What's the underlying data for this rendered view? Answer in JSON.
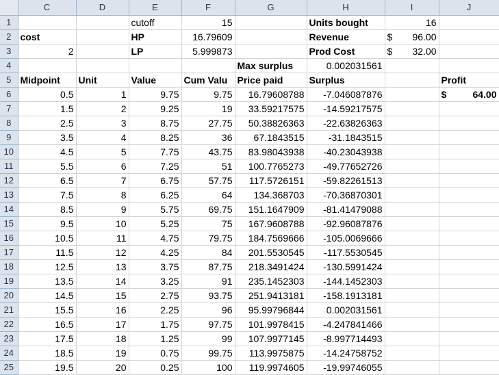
{
  "columns": [
    "C",
    "D",
    "E",
    "F",
    "G",
    "H",
    "I",
    "J"
  ],
  "rows": [
    {
      "n": "1",
      "cells": [
        {
          "v": ""
        },
        {
          "v": ""
        },
        {
          "v": "cutoff",
          "t": "txt"
        },
        {
          "v": "15",
          "t": "num"
        },
        {
          "v": ""
        },
        {
          "v": "Units bought",
          "t": "txt",
          "b": true
        },
        {
          "v": "16",
          "t": "num"
        },
        {
          "v": ""
        }
      ]
    },
    {
      "n": "2",
      "cells": [
        {
          "v": "cost",
          "t": "txt",
          "b": true
        },
        {
          "v": ""
        },
        {
          "v": "HP",
          "t": "txt",
          "b": true
        },
        {
          "v": "16.79609",
          "t": "num"
        },
        {
          "v": ""
        },
        {
          "v": "Revenue",
          "t": "txt",
          "b": true
        },
        {
          "v": "96.00",
          "t": "cur",
          "s": "$"
        },
        {
          "v": ""
        }
      ]
    },
    {
      "n": "3",
      "cells": [
        {
          "v": "2",
          "t": "num"
        },
        {
          "v": ""
        },
        {
          "v": "LP",
          "t": "txt",
          "b": true
        },
        {
          "v": "5.999873",
          "t": "num"
        },
        {
          "v": ""
        },
        {
          "v": "Prod Cost",
          "t": "txt",
          "b": true
        },
        {
          "v": "32.00",
          "t": "cur",
          "s": "$"
        },
        {
          "v": ""
        }
      ]
    },
    {
      "n": "4",
      "cells": [
        {
          "v": ""
        },
        {
          "v": ""
        },
        {
          "v": ""
        },
        {
          "v": ""
        },
        {
          "v": "Max surplus",
          "t": "txt",
          "b": true
        },
        {
          "v": "0.002031561",
          "t": "num"
        },
        {
          "v": ""
        },
        {
          "v": ""
        }
      ]
    },
    {
      "n": "5",
      "cells": [
        {
          "v": "Midpoint",
          "t": "txt",
          "b": true
        },
        {
          "v": "Unit",
          "t": "txt",
          "b": true
        },
        {
          "v": "Value",
          "t": "txt",
          "b": true
        },
        {
          "v": "Cum Valu",
          "t": "txt",
          "b": true
        },
        {
          "v": "Price paid",
          "t": "txt",
          "b": true
        },
        {
          "v": "Surplus",
          "t": "txt",
          "b": true
        },
        {
          "v": ""
        },
        {
          "v": "Profit",
          "t": "txt",
          "b": true
        }
      ]
    },
    {
      "n": "6",
      "cells": [
        {
          "v": "0.5",
          "t": "num"
        },
        {
          "v": "1",
          "t": "num"
        },
        {
          "v": "9.75",
          "t": "num"
        },
        {
          "v": "9.75",
          "t": "num"
        },
        {
          "v": "16.79608788",
          "t": "num"
        },
        {
          "v": "-7.046087876",
          "t": "num"
        },
        {
          "v": ""
        },
        {
          "v": "64.00",
          "t": "cur",
          "s": "$",
          "b": true
        }
      ]
    },
    {
      "n": "7",
      "cells": [
        {
          "v": "1.5",
          "t": "num"
        },
        {
          "v": "2",
          "t": "num"
        },
        {
          "v": "9.25",
          "t": "num"
        },
        {
          "v": "19",
          "t": "num"
        },
        {
          "v": "33.59217575",
          "t": "num"
        },
        {
          "v": "-14.59217575",
          "t": "num"
        },
        {
          "v": ""
        },
        {
          "v": ""
        }
      ]
    },
    {
      "n": "8",
      "cells": [
        {
          "v": "2.5",
          "t": "num"
        },
        {
          "v": "3",
          "t": "num"
        },
        {
          "v": "8.75",
          "t": "num"
        },
        {
          "v": "27.75",
          "t": "num"
        },
        {
          "v": "50.38826363",
          "t": "num"
        },
        {
          "v": "-22.63826363",
          "t": "num"
        },
        {
          "v": ""
        },
        {
          "v": ""
        }
      ]
    },
    {
      "n": "9",
      "cells": [
        {
          "v": "3.5",
          "t": "num"
        },
        {
          "v": "4",
          "t": "num"
        },
        {
          "v": "8.25",
          "t": "num"
        },
        {
          "v": "36",
          "t": "num"
        },
        {
          "v": "67.1843515",
          "t": "num"
        },
        {
          "v": "-31.1843515",
          "t": "num"
        },
        {
          "v": ""
        },
        {
          "v": ""
        }
      ]
    },
    {
      "n": "10",
      "cells": [
        {
          "v": "4.5",
          "t": "num"
        },
        {
          "v": "5",
          "t": "num"
        },
        {
          "v": "7.75",
          "t": "num"
        },
        {
          "v": "43.75",
          "t": "num"
        },
        {
          "v": "83.98043938",
          "t": "num"
        },
        {
          "v": "-40.23043938",
          "t": "num"
        },
        {
          "v": ""
        },
        {
          "v": ""
        }
      ]
    },
    {
      "n": "11",
      "cells": [
        {
          "v": "5.5",
          "t": "num"
        },
        {
          "v": "6",
          "t": "num"
        },
        {
          "v": "7.25",
          "t": "num"
        },
        {
          "v": "51",
          "t": "num"
        },
        {
          "v": "100.7765273",
          "t": "num"
        },
        {
          "v": "-49.77652726",
          "t": "num"
        },
        {
          "v": ""
        },
        {
          "v": ""
        }
      ]
    },
    {
      "n": "12",
      "cells": [
        {
          "v": "6.5",
          "t": "num"
        },
        {
          "v": "7",
          "t": "num"
        },
        {
          "v": "6.75",
          "t": "num"
        },
        {
          "v": "57.75",
          "t": "num"
        },
        {
          "v": "117.5726151",
          "t": "num"
        },
        {
          "v": "-59.82261513",
          "t": "num"
        },
        {
          "v": ""
        },
        {
          "v": ""
        }
      ]
    },
    {
      "n": "13",
      "cells": [
        {
          "v": "7.5",
          "t": "num"
        },
        {
          "v": "8",
          "t": "num"
        },
        {
          "v": "6.25",
          "t": "num"
        },
        {
          "v": "64",
          "t": "num"
        },
        {
          "v": "134.368703",
          "t": "num"
        },
        {
          "v": "-70.36870301",
          "t": "num"
        },
        {
          "v": ""
        },
        {
          "v": ""
        }
      ]
    },
    {
      "n": "14",
      "cells": [
        {
          "v": "8.5",
          "t": "num"
        },
        {
          "v": "9",
          "t": "num"
        },
        {
          "v": "5.75",
          "t": "num"
        },
        {
          "v": "69.75",
          "t": "num"
        },
        {
          "v": "151.1647909",
          "t": "num"
        },
        {
          "v": "-81.41479088",
          "t": "num"
        },
        {
          "v": ""
        },
        {
          "v": ""
        }
      ]
    },
    {
      "n": "15",
      "cells": [
        {
          "v": "9.5",
          "t": "num"
        },
        {
          "v": "10",
          "t": "num"
        },
        {
          "v": "5.25",
          "t": "num"
        },
        {
          "v": "75",
          "t": "num"
        },
        {
          "v": "167.9608788",
          "t": "num"
        },
        {
          "v": "-92.96087876",
          "t": "num"
        },
        {
          "v": ""
        },
        {
          "v": ""
        }
      ]
    },
    {
      "n": "16",
      "cells": [
        {
          "v": "10.5",
          "t": "num"
        },
        {
          "v": "11",
          "t": "num"
        },
        {
          "v": "4.75",
          "t": "num"
        },
        {
          "v": "79.75",
          "t": "num"
        },
        {
          "v": "184.7569666",
          "t": "num"
        },
        {
          "v": "-105.0069666",
          "t": "num"
        },
        {
          "v": ""
        },
        {
          "v": ""
        }
      ]
    },
    {
      "n": "17",
      "cells": [
        {
          "v": "11.5",
          "t": "num"
        },
        {
          "v": "12",
          "t": "num"
        },
        {
          "v": "4.25",
          "t": "num"
        },
        {
          "v": "84",
          "t": "num"
        },
        {
          "v": "201.5530545",
          "t": "num"
        },
        {
          "v": "-117.5530545",
          "t": "num"
        },
        {
          "v": ""
        },
        {
          "v": ""
        }
      ]
    },
    {
      "n": "18",
      "cells": [
        {
          "v": "12.5",
          "t": "num"
        },
        {
          "v": "13",
          "t": "num"
        },
        {
          "v": "3.75",
          "t": "num"
        },
        {
          "v": "87.75",
          "t": "num"
        },
        {
          "v": "218.3491424",
          "t": "num"
        },
        {
          "v": "-130.5991424",
          "t": "num"
        },
        {
          "v": ""
        },
        {
          "v": ""
        }
      ]
    },
    {
      "n": "19",
      "cells": [
        {
          "v": "13.5",
          "t": "num"
        },
        {
          "v": "14",
          "t": "num"
        },
        {
          "v": "3.25",
          "t": "num"
        },
        {
          "v": "91",
          "t": "num"
        },
        {
          "v": "235.1452303",
          "t": "num"
        },
        {
          "v": "-144.1452303",
          "t": "num"
        },
        {
          "v": ""
        },
        {
          "v": ""
        }
      ]
    },
    {
      "n": "20",
      "cells": [
        {
          "v": "14.5",
          "t": "num"
        },
        {
          "v": "15",
          "t": "num"
        },
        {
          "v": "2.75",
          "t": "num"
        },
        {
          "v": "93.75",
          "t": "num"
        },
        {
          "v": "251.9413181",
          "t": "num"
        },
        {
          "v": "-158.1913181",
          "t": "num"
        },
        {
          "v": ""
        },
        {
          "v": ""
        }
      ]
    },
    {
      "n": "21",
      "cells": [
        {
          "v": "15.5",
          "t": "num"
        },
        {
          "v": "16",
          "t": "num"
        },
        {
          "v": "2.25",
          "t": "num"
        },
        {
          "v": "96",
          "t": "num"
        },
        {
          "v": "95.99796844",
          "t": "num"
        },
        {
          "v": "0.002031561",
          "t": "num"
        },
        {
          "v": ""
        },
        {
          "v": ""
        }
      ]
    },
    {
      "n": "22",
      "cells": [
        {
          "v": "16.5",
          "t": "num"
        },
        {
          "v": "17",
          "t": "num"
        },
        {
          "v": "1.75",
          "t": "num"
        },
        {
          "v": "97.75",
          "t": "num"
        },
        {
          "v": "101.9978415",
          "t": "num"
        },
        {
          "v": "-4.247841466",
          "t": "num"
        },
        {
          "v": ""
        },
        {
          "v": ""
        }
      ]
    },
    {
      "n": "23",
      "cells": [
        {
          "v": "17.5",
          "t": "num"
        },
        {
          "v": "18",
          "t": "num"
        },
        {
          "v": "1.25",
          "t": "num"
        },
        {
          "v": "99",
          "t": "num"
        },
        {
          "v": "107.9977145",
          "t": "num"
        },
        {
          "v": "-8.997714493",
          "t": "num"
        },
        {
          "v": ""
        },
        {
          "v": ""
        }
      ]
    },
    {
      "n": "24",
      "cells": [
        {
          "v": "18.5",
          "t": "num"
        },
        {
          "v": "19",
          "t": "num"
        },
        {
          "v": "0.75",
          "t": "num"
        },
        {
          "v": "99.75",
          "t": "num"
        },
        {
          "v": "113.9975875",
          "t": "num"
        },
        {
          "v": "-14.24758752",
          "t": "num"
        },
        {
          "v": ""
        },
        {
          "v": ""
        }
      ]
    },
    {
      "n": "25",
      "cells": [
        {
          "v": "19.5",
          "t": "num"
        },
        {
          "v": "20",
          "t": "num"
        },
        {
          "v": "0.25",
          "t": "num"
        },
        {
          "v": "100",
          "t": "num"
        },
        {
          "v": "119.9974605",
          "t": "num"
        },
        {
          "v": "-19.99746055",
          "t": "num"
        },
        {
          "v": ""
        },
        {
          "v": ""
        }
      ]
    }
  ]
}
